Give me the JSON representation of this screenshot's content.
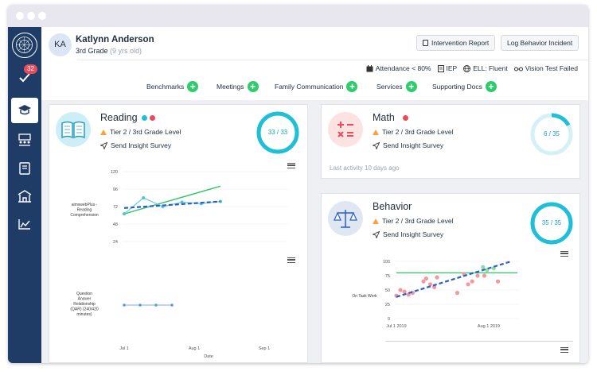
{
  "student": {
    "initials": "KA",
    "name": "Katlynn Anderson",
    "grade": "3rd Grade",
    "age": "(9 yrs old)"
  },
  "header": {
    "intervention_report": "Intervention Report",
    "log_behavior": "Log Behavior Incident"
  },
  "sidebar": {
    "badge_count": "32"
  },
  "attributes": [
    "Attendance < 80%",
    "IEP",
    "ELL: Fluent",
    "Vision Test Failed"
  ],
  "tabs": [
    "Benchmarks",
    "Meetings",
    "Family Communication",
    "Services",
    "Supporting Docs"
  ],
  "colors": {
    "accent_green": "#2fcc6e",
    "ring_teal": "#1fbfd8",
    "trend_blue": "#2b5fc8",
    "target_green": "#3cc46e",
    "point_red": "#f09aa0",
    "sidebar_navy": "#1e3c66"
  },
  "reading": {
    "title": "Reading",
    "tier": "Tier 2 / 3rd Grade Level",
    "survey": "Send Insight Survey",
    "score": "33 / 33",
    "score_fraction": 1.0
  },
  "math": {
    "title": "Math",
    "tier": "Tier 2 / 3rd Grade Level",
    "survey": "Send Insight Survey",
    "score": "6 / 35",
    "score_fraction": 0.171,
    "last_activity": "Last activity 10 days ago"
  },
  "behavior": {
    "title": "Behavior",
    "tier": "Tier 2 / 3rd Grade Level",
    "survey": "Send Insight Survey",
    "score": "35 / 35",
    "score_fraction": 1.0
  },
  "chart_data": [
    {
      "type": "line",
      "ylabel": "aimswebPlus - Reading Comprehension",
      "y_ticks": [
        "120",
        "96",
        "72",
        "48",
        "24"
      ],
      "ylim": [
        24,
        120
      ],
      "series": [
        {
          "values": [
            62,
            84,
            72,
            78,
            76,
            79
          ]
        }
      ],
      "goal_line": [
        62,
        100
      ],
      "trend_line": [
        70,
        79
      ]
    },
    {
      "type": "line",
      "ylabel": "Question Answer Relationship (QAR) (240/420 minutes)",
      "x_ticks": [
        "Jul 1",
        "Aug 1",
        "Sep 1"
      ],
      "xlabel": "Date",
      "series": [
        {
          "values": [
            1,
            1,
            1,
            1
          ]
        }
      ]
    },
    {
      "type": "scatter",
      "ylabel": "On Task Work",
      "y_ticks": [
        "100",
        "75",
        "50",
        "25",
        "0"
      ],
      "x_ticks": [
        "Jul 1 2019",
        "Aug 1 2019"
      ],
      "ylim": [
        0,
        100
      ],
      "points": [
        [
          0.0,
          40
        ],
        [
          0.3,
          50
        ],
        [
          0.6,
          47
        ],
        [
          0.9,
          42
        ],
        [
          1.2,
          45
        ],
        [
          2.0,
          65
        ],
        [
          2.2,
          70
        ],
        [
          2.5,
          60
        ],
        [
          2.8,
          55
        ],
        [
          3.0,
          72
        ],
        [
          4.5,
          45
        ],
        [
          5.0,
          78
        ],
        [
          5.3,
          60
        ],
        [
          5.6,
          65
        ],
        [
          6.0,
          75
        ],
        [
          6.4,
          90
        ],
        [
          6.5,
          75
        ],
        [
          6.7,
          85
        ],
        [
          7.2,
          88
        ],
        [
          7.5,
          65
        ]
      ],
      "target_value": 80,
      "trend_line": [
        38,
        100
      ]
    }
  ]
}
